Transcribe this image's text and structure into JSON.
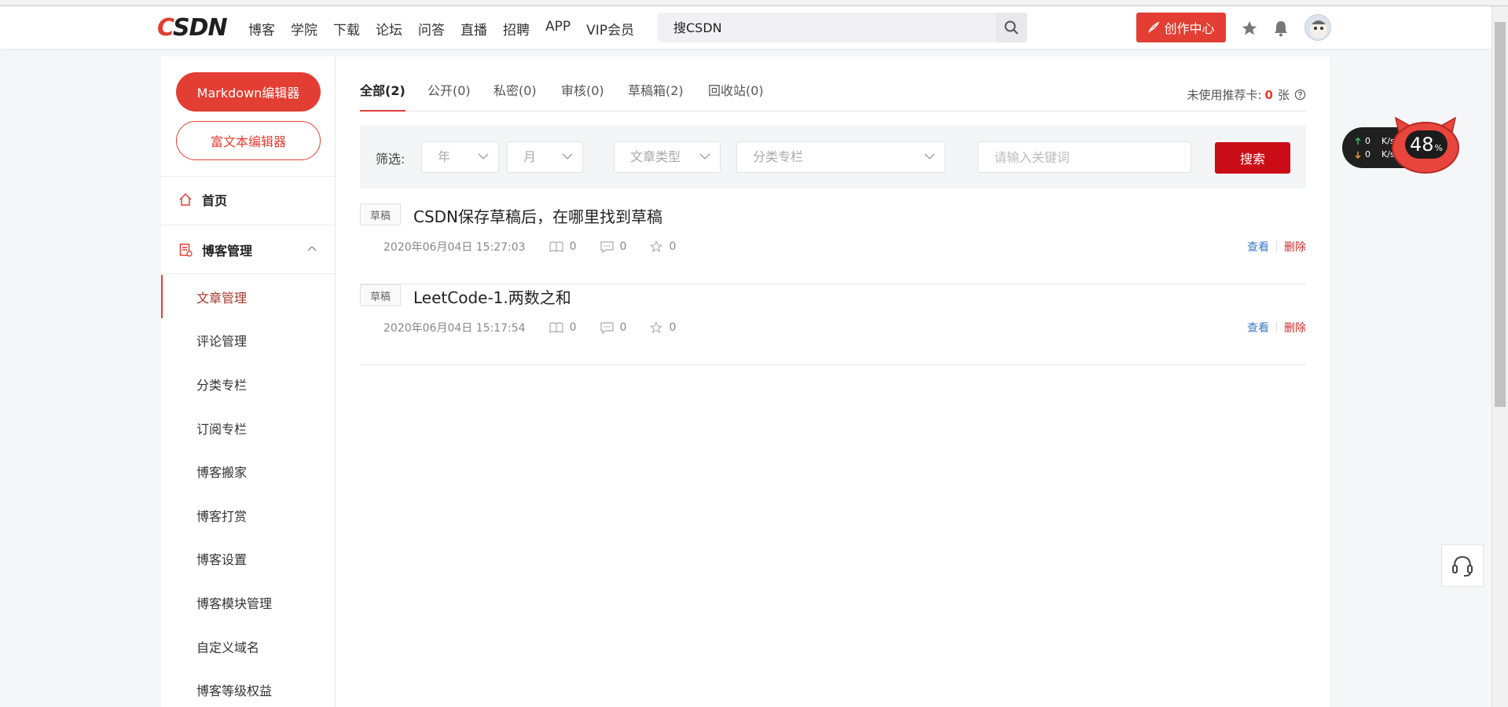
{
  "navbar": {
    "logo_c": "C",
    "logo_rest": "SDN",
    "links": [
      "博客",
      "学院",
      "下载",
      "论坛",
      "问答",
      "直播",
      "招聘",
      "APP",
      "VIP会员"
    ],
    "search_placeholder": "搜CSDN",
    "create_label": "创作中心",
    "colors": {
      "brand": "#e33e33"
    }
  },
  "sidebar": {
    "markdown_btn": "Markdown编辑器",
    "rich_btn": "富文本编辑器",
    "home": "首页",
    "group": "博客管理",
    "items": [
      "文章管理",
      "评论管理",
      "分类专栏",
      "订阅专栏",
      "博客搬家",
      "博客打赏",
      "博客设置",
      "博客模块管理",
      "自定义域名",
      "博客等级权益"
    ]
  },
  "tabs": [
    {
      "label": "全部(2)",
      "active": true
    },
    {
      "label": "公开(0)",
      "active": false
    },
    {
      "label": "私密(0)",
      "active": false
    },
    {
      "label": "审核(0)",
      "active": false
    },
    {
      "label": "草稿箱(2)",
      "active": false
    },
    {
      "label": "回收站(0)",
      "active": false
    }
  ],
  "unused_card": {
    "label": "未使用推荐卡:",
    "count": "0",
    "unit": "张"
  },
  "filter": {
    "label": "筛选:",
    "year": "年",
    "month": "月",
    "type": "文章类型",
    "category": "分类专栏",
    "keyword_placeholder": "请输入关键词",
    "search_btn": "搜索"
  },
  "articles": [
    {
      "tag": "草稿",
      "title": "CSDN保存草稿后，在哪里找到草稿",
      "date": "2020年06月04日 15:27:03",
      "reads": "0",
      "comments": "0",
      "stars": "0",
      "view": "查看",
      "delete": "删除"
    },
    {
      "tag": "草稿",
      "title": "LeetCode-1.两数之和",
      "date": "2020年06月04日 15:17:54",
      "reads": "0",
      "comments": "0",
      "stars": "0",
      "view": "查看",
      "delete": "删除"
    }
  ],
  "net_widget": {
    "up": "0",
    "down": "0",
    "unit": "K/s",
    "percent": "48",
    "percent_sign": "%"
  }
}
